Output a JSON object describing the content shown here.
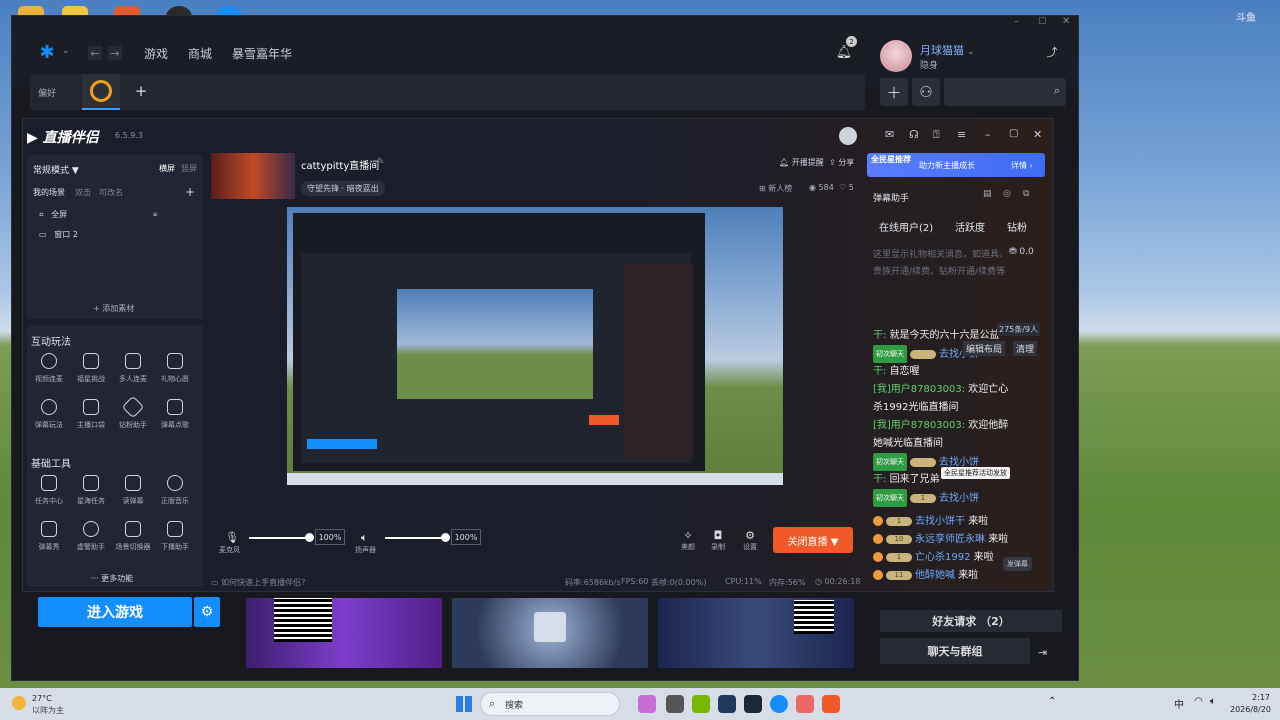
{
  "app": {
    "nav": [
      "游戏",
      "商城",
      "暴雪嘉年华"
    ],
    "notification_count": "2",
    "user": {
      "name": "月球猫猫",
      "status": "隐身"
    },
    "tab_prefix": "偏好",
    "play_button": "进入游戏",
    "friend_request": "好友请求 （2）",
    "chat_groups": "聊天与群组"
  },
  "live": {
    "logo_text": "直播伴侣",
    "version": "6.5.9.3",
    "mode": "常规模式 ▼",
    "orient_h": "横屏",
    "orient_v": "竖屏",
    "scene_title": "我的场景",
    "scene_dual": "双击",
    "scene_addable": "可改名",
    "scenes": [
      "全屏",
      "窗口 2"
    ],
    "add_material": "添加素材",
    "interact_title": "互动玩法",
    "interact_tools": [
      "视频连麦",
      "福星挑战",
      "多人连麦",
      "礼物心愿",
      "弹幕玩法",
      "主播口袋",
      "钻粉助手",
      "弹幕点歌"
    ],
    "basic_title": "基础工具",
    "basic_tools": [
      "任务中心",
      "星海任务",
      "读弹幕",
      "正版音乐",
      "弹幕秀",
      "虚警助手",
      "场景切换器",
      "下播助手"
    ],
    "more": "更多功能",
    "room_name": "cattypitty直播间",
    "room_sub": "守望先锋 · 暗夜蓝出",
    "open_remind": "开播提醒",
    "share": "分享",
    "new_fans": "新人榜",
    "viewers": "584",
    "likes": "5",
    "mic_label": "麦克风",
    "mic_pct": "100%",
    "speaker_label": "扬声器",
    "speaker_pct": "100%",
    "btn_beauty": "美颜",
    "btn_record": "录制",
    "btn_settings": "设置",
    "close_live": "关闭直播 ▼",
    "help_text": "如何快速上手直播伴侣?",
    "stats": {
      "bitrate": "码率:6586kb/s",
      "fps": "FPS:60",
      "drop": "丢帧:0(0.00%)",
      "cpu": "CPU:11%",
      "mem": "内存:56%",
      "time": "00:26:18"
    }
  },
  "chat": {
    "banner_left": "全民星推荐",
    "banner_mid": "助力新主播成长",
    "banner_btn": "详情 ›",
    "helper_title": "弹幕助手",
    "tabs": [
      "在线用户(2)",
      "活跃度",
      "钻粉"
    ],
    "gift_hint": "这里显示礼物相关消息，如道具、贵族开通/续费、钻粉开通/续费等",
    "gift_value": "0.0",
    "counter": "275条/9人",
    "menu_layout": "编辑布局",
    "menu_clear": "清理",
    "tooltip": "全民星推荐活动发放",
    "float": "发弹幕",
    "lines": [
      {
        "prefix": "干:",
        "text": "就是今天的六十六是公益"
      },
      {
        "tag": "初次聊天",
        "lvl": "",
        "text": "去找小饼"
      },
      {
        "prefix": "干:",
        "text": "自恋喔"
      },
      {
        "green": "[我]用户87803003:",
        "text": "欢迎亡心杀1992光临直播间"
      },
      {
        "green": "[我]用户87803003:",
        "text": "欢迎他醉她喊光临直播间"
      },
      {
        "tag": "初次聊天",
        "lvl": "",
        "text": "去找小饼"
      },
      {
        "prefix": "干:",
        "text": "回来了兄弟"
      },
      {
        "tag": "初次聊天",
        "lvl": "1",
        "text": "去找小饼"
      },
      {
        "lvl": "1",
        "name": "去找小饼干",
        "text": "来啦"
      },
      {
        "lvl": "10",
        "name": "永远孪师匠永琳",
        "text": "来啦"
      },
      {
        "lvl": "1",
        "name": "亡心杀1992",
        "text": "来啦"
      },
      {
        "lvl": "11",
        "name": "他醉她喊",
        "text": "来啦"
      }
    ]
  },
  "taskbar": {
    "weather_temp": "27°C",
    "weather_desc": "以阵为主",
    "search": "搜索",
    "ime": "中",
    "time": "2:17",
    "date": "2026/8/20"
  }
}
